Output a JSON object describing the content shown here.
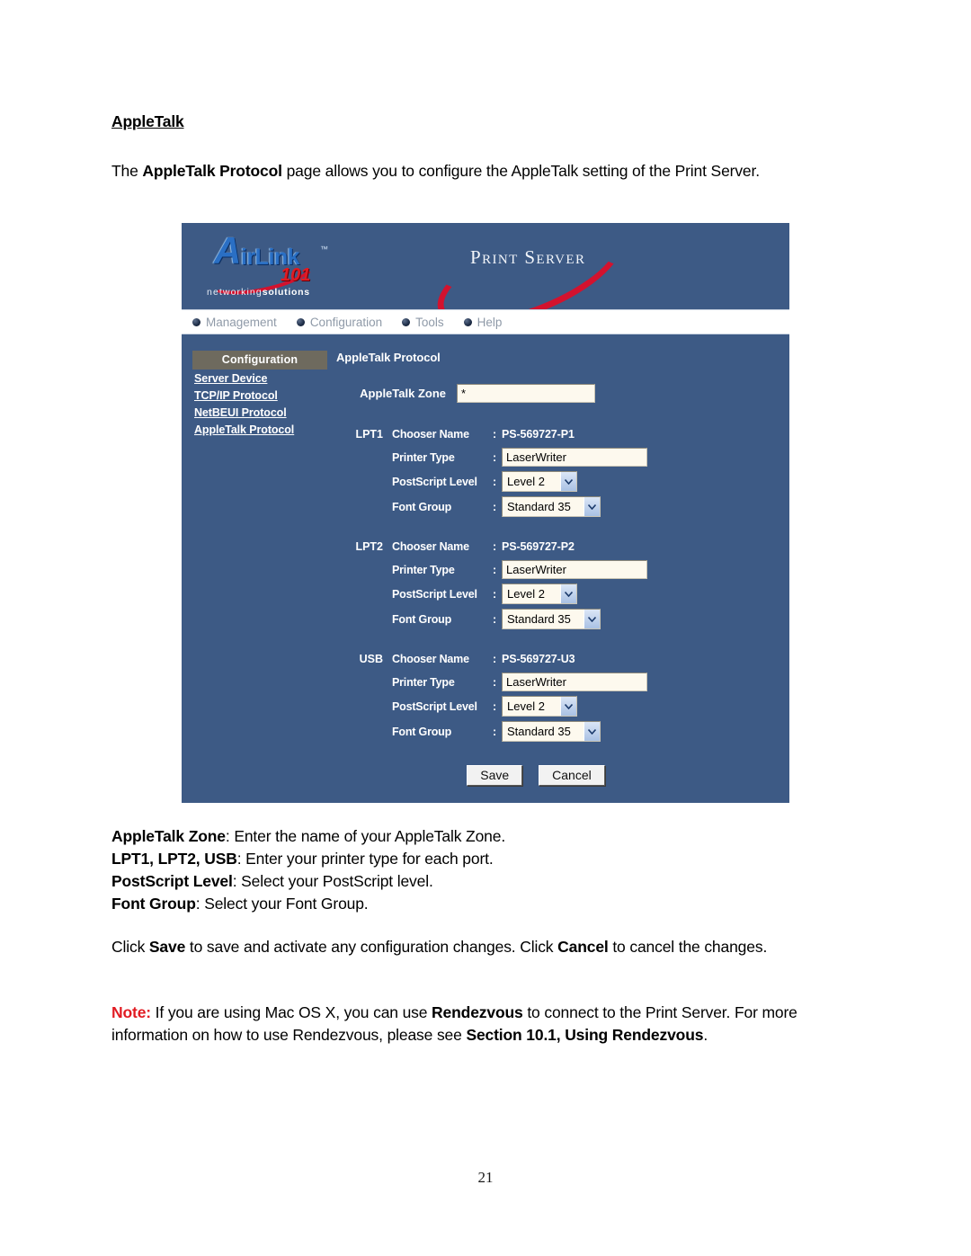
{
  "document": {
    "heading": "AppleTalk",
    "intro": {
      "prefix": "The ",
      "bold": "AppleTalk Protocol",
      "suffix": " page allows you to configure the AppleTalk setting of the Print Server."
    },
    "definitions": [
      {
        "term": "AppleTalk Zone",
        "desc": ": Enter the name of your AppleTalk Zone."
      },
      {
        "term": "LPT1, LPT2, USB",
        "desc": ": Enter your printer type for each port."
      },
      {
        "term": "PostScript Level",
        "desc": ": Select your PostScript level."
      },
      {
        "term": "Font Group",
        "desc": ": Select your Font Group."
      }
    ],
    "save_paragraph": {
      "p1": "Click ",
      "b1": "Save",
      "p2": " to save and activate any configuration changes. Click ",
      "b2": "Cancel",
      "p3": " to cancel the changes."
    },
    "note": {
      "label": "Note:",
      "p1": " If you are using Mac OS X, you can use ",
      "b1": "Rendezvous",
      "p2": " to connect to the Print Server. For more information on how to use Rendezvous, please see ",
      "b2": "Section 10.1, Using Rendezvous",
      "p3": "."
    },
    "page_number": "21"
  },
  "screenshot": {
    "logo": {
      "letter_a": "A",
      "wordmark": "irLink",
      "trademark": "™",
      "number": "101",
      "tagline_light": "networking",
      "tagline_bold": "solutions"
    },
    "brand": {
      "title": "Print Server"
    },
    "menubar": {
      "items": [
        {
          "label": "Management"
        },
        {
          "label": "Configuration"
        },
        {
          "label": "Tools"
        },
        {
          "label": "Help"
        }
      ]
    },
    "sidebar": {
      "title": "Configuration",
      "links": [
        {
          "label": "Server Device"
        },
        {
          "label": "TCP/IP Protocol"
        },
        {
          "label": "NetBEUI Protocol"
        },
        {
          "label": "AppleTalk Protocol"
        }
      ]
    },
    "form": {
      "title": "AppleTalk Protocol",
      "zone": {
        "label": "AppleTalk Zone",
        "value": "*"
      },
      "field_labels": {
        "chooser_name": "Chooser Name",
        "printer_type": "Printer Type",
        "postscript_level": "PostScript Level",
        "font_group": "Font Group",
        "colon": ":"
      },
      "ports": [
        {
          "name": "LPT1",
          "chooser_name": "PS-569727-P1",
          "printer_type": "LaserWriter",
          "postscript_level": "Level 2",
          "font_group": "Standard 35"
        },
        {
          "name": "LPT2",
          "chooser_name": "PS-569727-P2",
          "printer_type": "LaserWriter",
          "postscript_level": "Level 2",
          "font_group": "Standard 35"
        },
        {
          "name": "USB",
          "chooser_name": "PS-569727-U3",
          "printer_type": "LaserWriter",
          "postscript_level": "Level 2",
          "font_group": "Standard 35"
        }
      ],
      "buttons": {
        "save": "Save",
        "cancel": "Cancel"
      }
    },
    "colors": {
      "panel_blue": "#3d5a85",
      "sidebar_title_bg": "#6e6a5e",
      "input_cream": "#fdf9ee",
      "accent_red": "#d3122e",
      "logo_blue": "#2a6fc4"
    }
  }
}
